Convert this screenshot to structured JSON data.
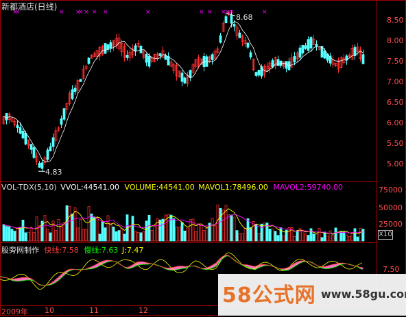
{
  "price_panel": {
    "title": "新都酒店(日线)",
    "high_label": "8.68",
    "low_label": "4.83",
    "axis_ticks": [
      "8.50",
      "8.00",
      "7.50",
      "7.00",
      "6.50",
      "6.00",
      "5.50",
      "5.00"
    ]
  },
  "volume_panel": {
    "title": "VOL-TDX(5,10)",
    "vvol": "VVOL:44541.00",
    "volume": "VOLUME:44541.00",
    "mavol1": "MAVOL1:78496.00",
    "mavol2": "MAVOL2:59740.00",
    "axis_ticks": [
      "75000",
      "50000",
      "25000"
    ],
    "unit_badge": "X10"
  },
  "indicator_panel": {
    "title": "股旁网制作",
    "fast": "快线:7.58",
    "slow": "慢线:7.63",
    "j": "J:7.47",
    "axis_tick": "7.50"
  },
  "date_axis": {
    "labels": [
      "2009年",
      "10",
      "11",
      "12"
    ]
  },
  "watermark": {
    "logo": "58公式网",
    "url": "www.58gu.com"
  },
  "colors": {
    "up": "#ff3030",
    "down": "#54ffff",
    "ma": "#ff00ff",
    "axis": "#a00000",
    "vvol": "#ffffff",
    "volume": "#ffff00",
    "mavol1": "#ffff00",
    "mavol2": "#ff00ff",
    "fast": "#ff4040",
    "slow": "#00ff00",
    "j": "#ffff00"
  }
}
